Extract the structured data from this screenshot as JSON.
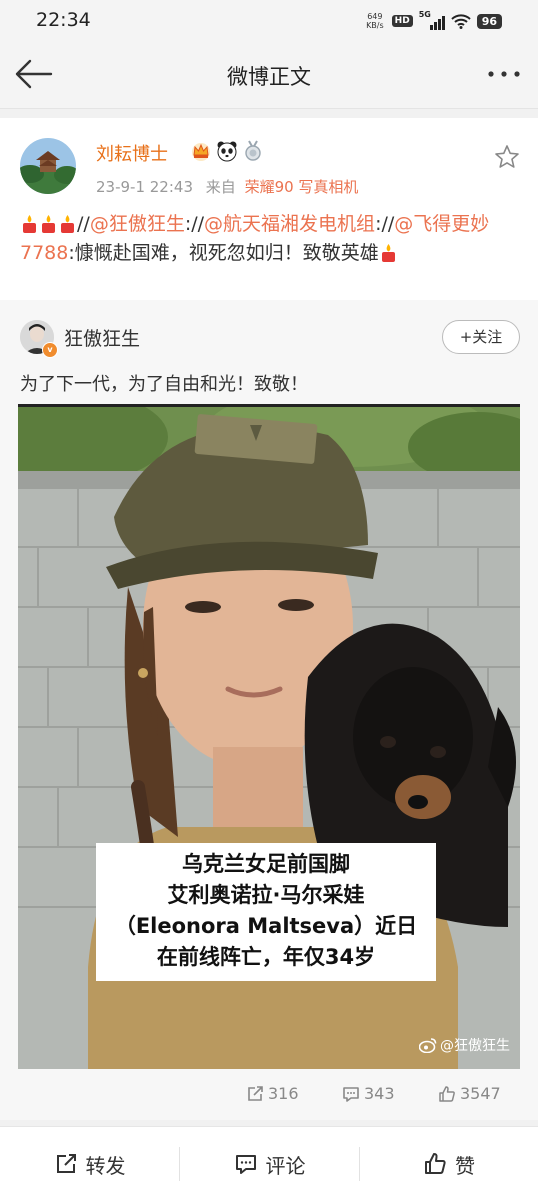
{
  "status_bar": {
    "time": "22:34",
    "net_speed_value": "649",
    "net_speed_unit": "KB/s",
    "hd_label": "HD",
    "network_label": "5G",
    "battery": "96"
  },
  "nav": {
    "title": "微博正文"
  },
  "post": {
    "author": "刘耘博士",
    "time": "23-9-1 22:43",
    "source_prefix": "来自",
    "source": "荣耀90 写真相机",
    "text_parts": {
      "sep1": "//",
      "m1": "@狂傲狂生",
      "sep2": ":",
      "sep3": "//",
      "m2": "@航天福湘发电机组",
      "sep4": ":",
      "sep5": "//",
      "m3": "@飞得更妙7788",
      "body": ":慷慨赴国难，视死忽如归！致敬英雄"
    }
  },
  "quoted": {
    "author": "狂傲狂生",
    "follow_label": "+关注",
    "text": "为了下一代，为了自由和光！致敬！",
    "image_caption": [
      "乌克兰女足前国脚",
      "艾利奥诺拉·马尔采娃",
      "（Eleonora Maltseva）近日",
      "在前线阵亡，年仅34岁"
    ],
    "watermark": "@狂傲狂生",
    "stats": {
      "reposts": "316",
      "comments": "343",
      "likes": "3547"
    }
  },
  "actions": {
    "repost": "转发",
    "comment": "评论",
    "like": "赞"
  },
  "colors": {
    "accent": "#eb7350",
    "username": "#e8711a",
    "muted": "#999999"
  }
}
